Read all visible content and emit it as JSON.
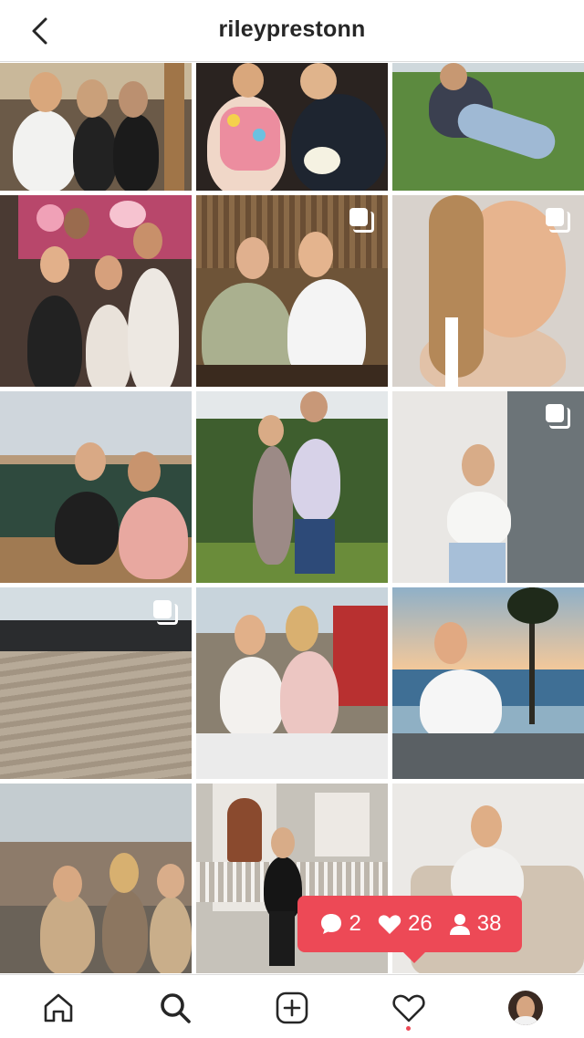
{
  "header": {
    "username": "rileyprestonn",
    "back_icon": "chevron-left-icon"
  },
  "grid": {
    "posts": [
      {
        "multi": false
      },
      {
        "multi": false
      },
      {
        "multi": false
      },
      {
        "multi": false
      },
      {
        "multi": true
      },
      {
        "multi": true
      },
      {
        "multi": false
      },
      {
        "multi": false
      },
      {
        "multi": true
      },
      {
        "multi": true
      },
      {
        "multi": false
      },
      {
        "multi": false
      },
      {
        "multi": false
      },
      {
        "multi": false
      },
      {
        "multi": false
      }
    ]
  },
  "activity": {
    "comments": "2",
    "likes": "26",
    "follows": "38",
    "color": "#ed4956"
  },
  "bottom_nav": {
    "items": [
      "home-icon",
      "search-icon",
      "new-post-icon",
      "activity-icon",
      "profile-avatar"
    ],
    "notification_color": "#ed4956"
  }
}
